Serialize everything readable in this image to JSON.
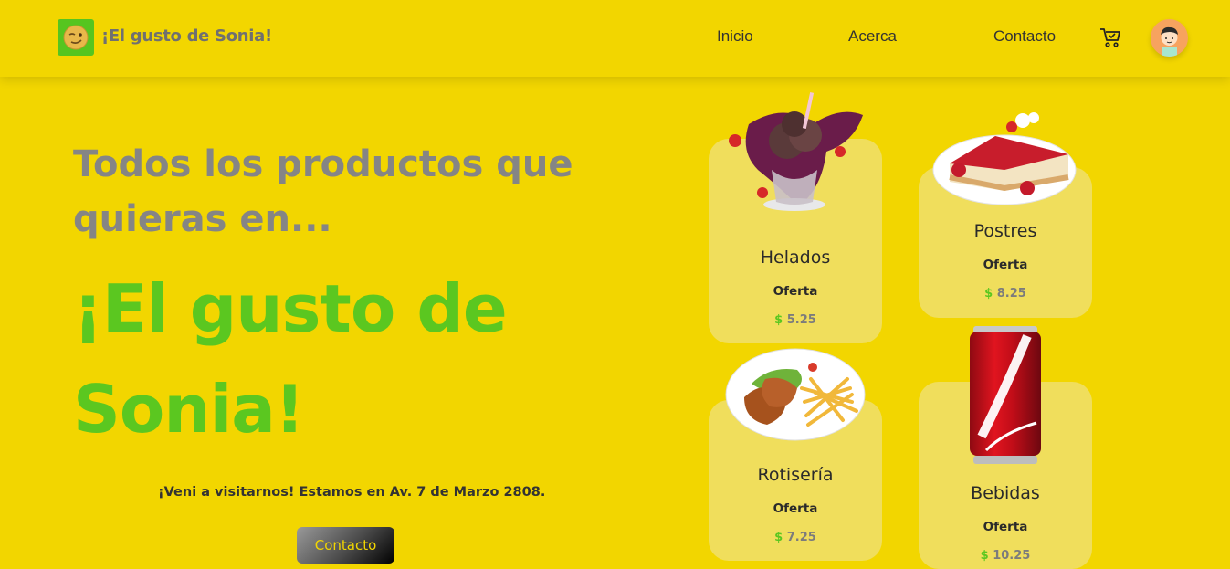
{
  "header": {
    "brand": "¡El gusto de Sonia!",
    "logo_icon": "smirk-emoji-icon",
    "nav": [
      "Inicio",
      "Acerca",
      "Contacto"
    ],
    "cart_icon": "cart-icon",
    "avatar_icon": "user-avatar-icon"
  },
  "hero": {
    "subtitle": "Todos los productos que quieras en...",
    "title": "¡El gusto de Sonia!",
    "address": "¡Veni a visitarnos! Estamos en Av. 7 de Marzo 2808.",
    "cta_label": "Contacto"
  },
  "cards": [
    {
      "title": "Helados",
      "tag": "Oferta",
      "currency": "$",
      "price": "5.25",
      "icon": "ice-cream-icon"
    },
    {
      "title": "Postres",
      "tag": "Oferta",
      "currency": "$",
      "price": "8.25",
      "icon": "cheesecake-icon"
    },
    {
      "title": "Rotisería",
      "tag": "Oferta",
      "currency": "$",
      "price": "7.25",
      "icon": "chicken-fries-plate-icon"
    },
    {
      "title": "Bebidas",
      "tag": "Oferta",
      "currency": "$",
      "price": "10.25",
      "icon": "soda-can-icon"
    }
  ],
  "colors": {
    "background": "#f2d600",
    "accent_green": "#5bc720",
    "card": "#f0de5c",
    "muted_text": "#858585"
  }
}
